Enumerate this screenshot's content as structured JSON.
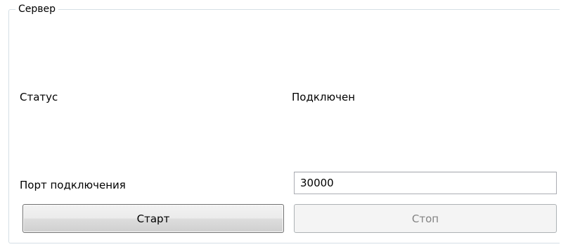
{
  "groupbox": {
    "title": "Сервер"
  },
  "status": {
    "label": "Статус",
    "value": "Подключен"
  },
  "port": {
    "label": "Порт подключения",
    "value": "30000"
  },
  "buttons": {
    "start_label": "Старт",
    "stop_label": "Стоп",
    "stop_enabled": false
  }
}
